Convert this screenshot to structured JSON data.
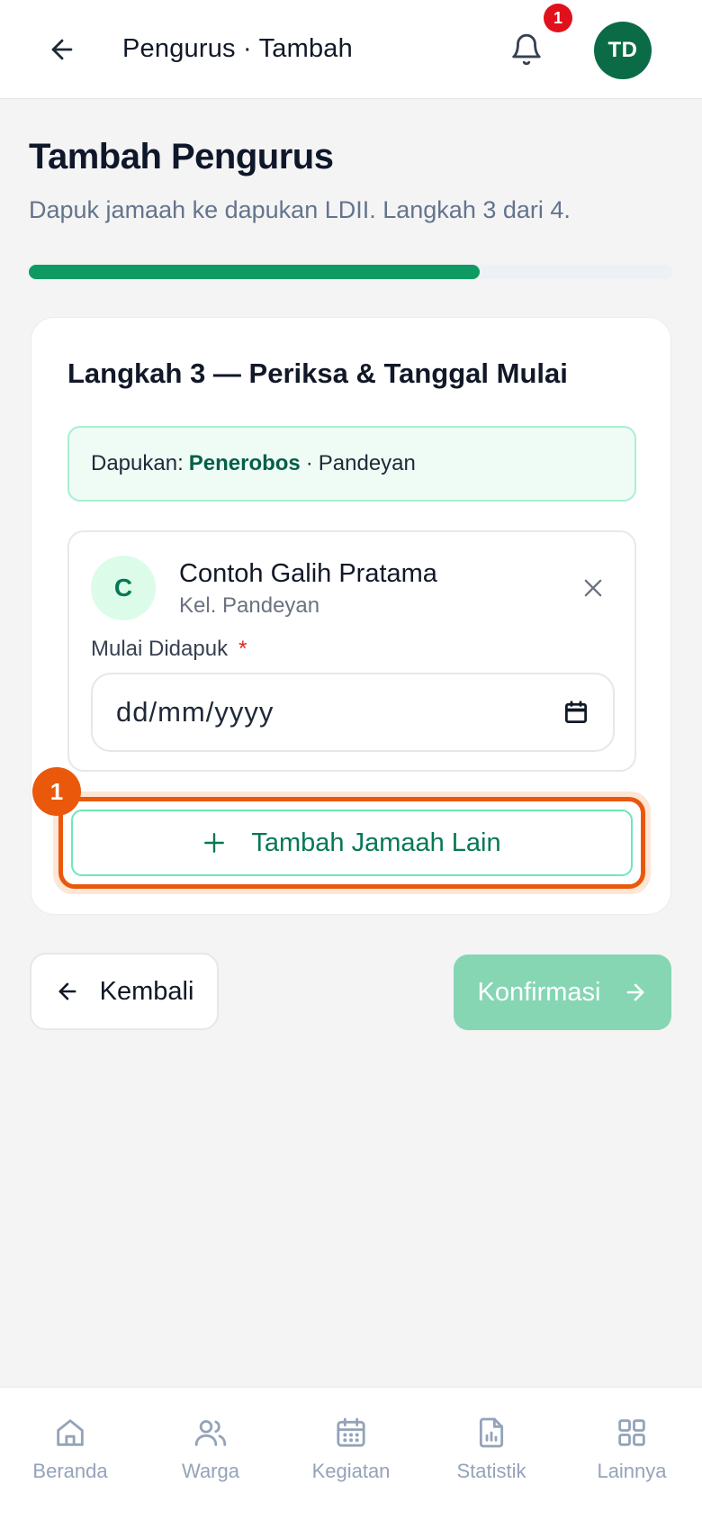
{
  "header": {
    "title": "Pengurus · Tambah",
    "notification_count": "1",
    "avatar_initials": "TD"
  },
  "page": {
    "title": "Tambah Pengurus",
    "subtitle": "Dapuk jamaah ke dapukan LDII. Langkah 3 dari 4.",
    "progress": {
      "current_step": 3,
      "total_steps": 4,
      "fraction": 0.7
    }
  },
  "card": {
    "step_title": "Langkah 3 — Periksa & Tanggal Mulai",
    "dapukan": {
      "prefix": "Dapukan:",
      "role": "Penerobos",
      "separator": "·",
      "location": "Pandeyan"
    },
    "member": {
      "initial": "C",
      "name": "Contoh Galih Pratama",
      "subtitle": "Kel. Pandeyan",
      "date_label": "Mulai Didapuk",
      "required_mark": "*",
      "date_placeholder": "dd/mm/yyyy"
    },
    "add_button_label": "Tambah Jamaah Lain",
    "highlight_badge": "1"
  },
  "actions": {
    "back_label": "Kembali",
    "confirm_label": "Konfirmasi"
  },
  "bottom_nav": {
    "items": [
      {
        "label": "Beranda",
        "icon": "home-icon"
      },
      {
        "label": "Warga",
        "icon": "users-icon"
      },
      {
        "label": "Kegiatan",
        "icon": "calendar-icon"
      },
      {
        "label": "Statistik",
        "icon": "report-chart-icon"
      },
      {
        "label": "Lainnya",
        "icon": "grid-icon"
      }
    ]
  },
  "colors": {
    "brand": "#0b6b46",
    "progress": "#0f9a63",
    "highlight": "#ea580c",
    "badge": "#e0111b",
    "confirm_disabled": "#86d6b4"
  }
}
